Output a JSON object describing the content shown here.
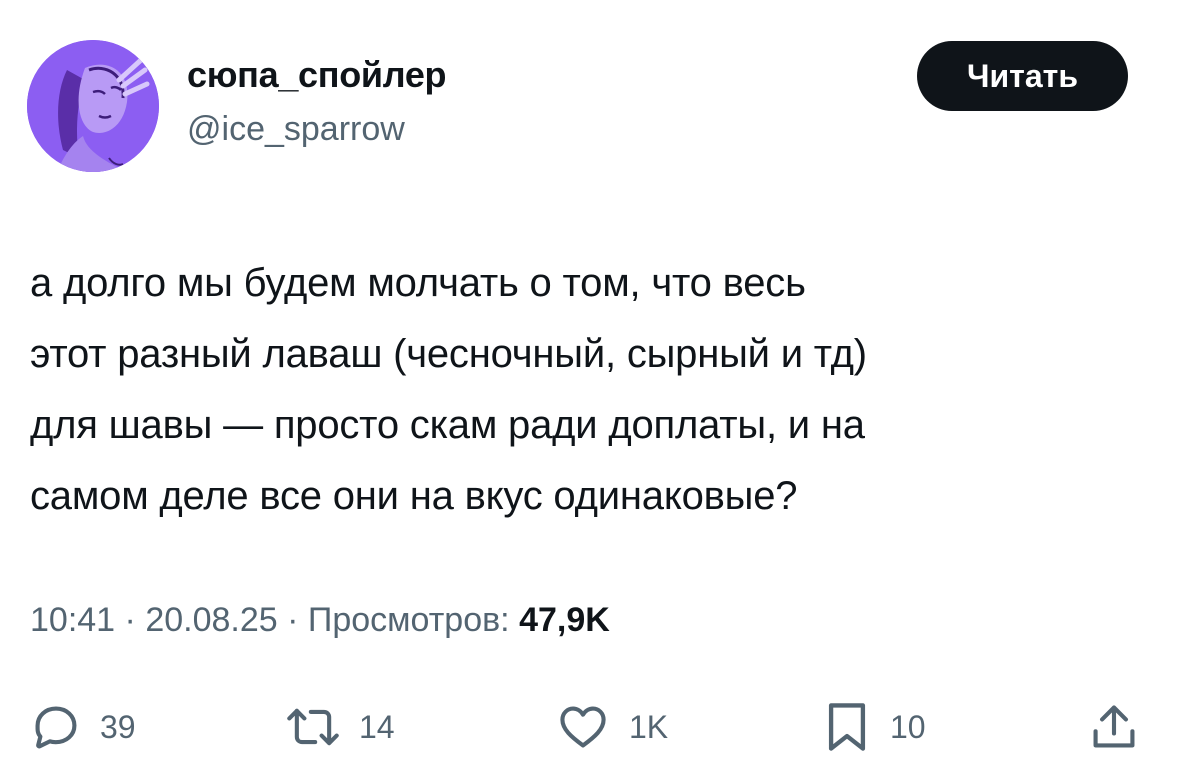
{
  "author": {
    "display_name": "сюпа_спойлер",
    "handle": "@ice_sparrow",
    "avatar_bg": "#8c5ef2"
  },
  "follow_button": {
    "label": "Читать"
  },
  "tweet": {
    "lines": [
      "а долго мы будем молчать о том, что весь",
      "этот разный лаваш (чесночный, сырный и тд)",
      "для шавы — просто скам ради доплаты, и на",
      "самом деле все они на вкус одинаковые?"
    ]
  },
  "meta": {
    "time": "10:41",
    "date": "20.08.25",
    "separator": "·",
    "views_label": "Просмотров:",
    "views_count": "47,9K"
  },
  "actions": {
    "replies": {
      "icon": "reply-icon",
      "count": "39"
    },
    "retweets": {
      "icon": "retweet-icon",
      "count": "14"
    },
    "likes": {
      "icon": "heart-icon",
      "count": "1K"
    },
    "bookmarks": {
      "icon": "bookmark-icon",
      "count": "10"
    },
    "share": {
      "icon": "share-icon"
    }
  }
}
